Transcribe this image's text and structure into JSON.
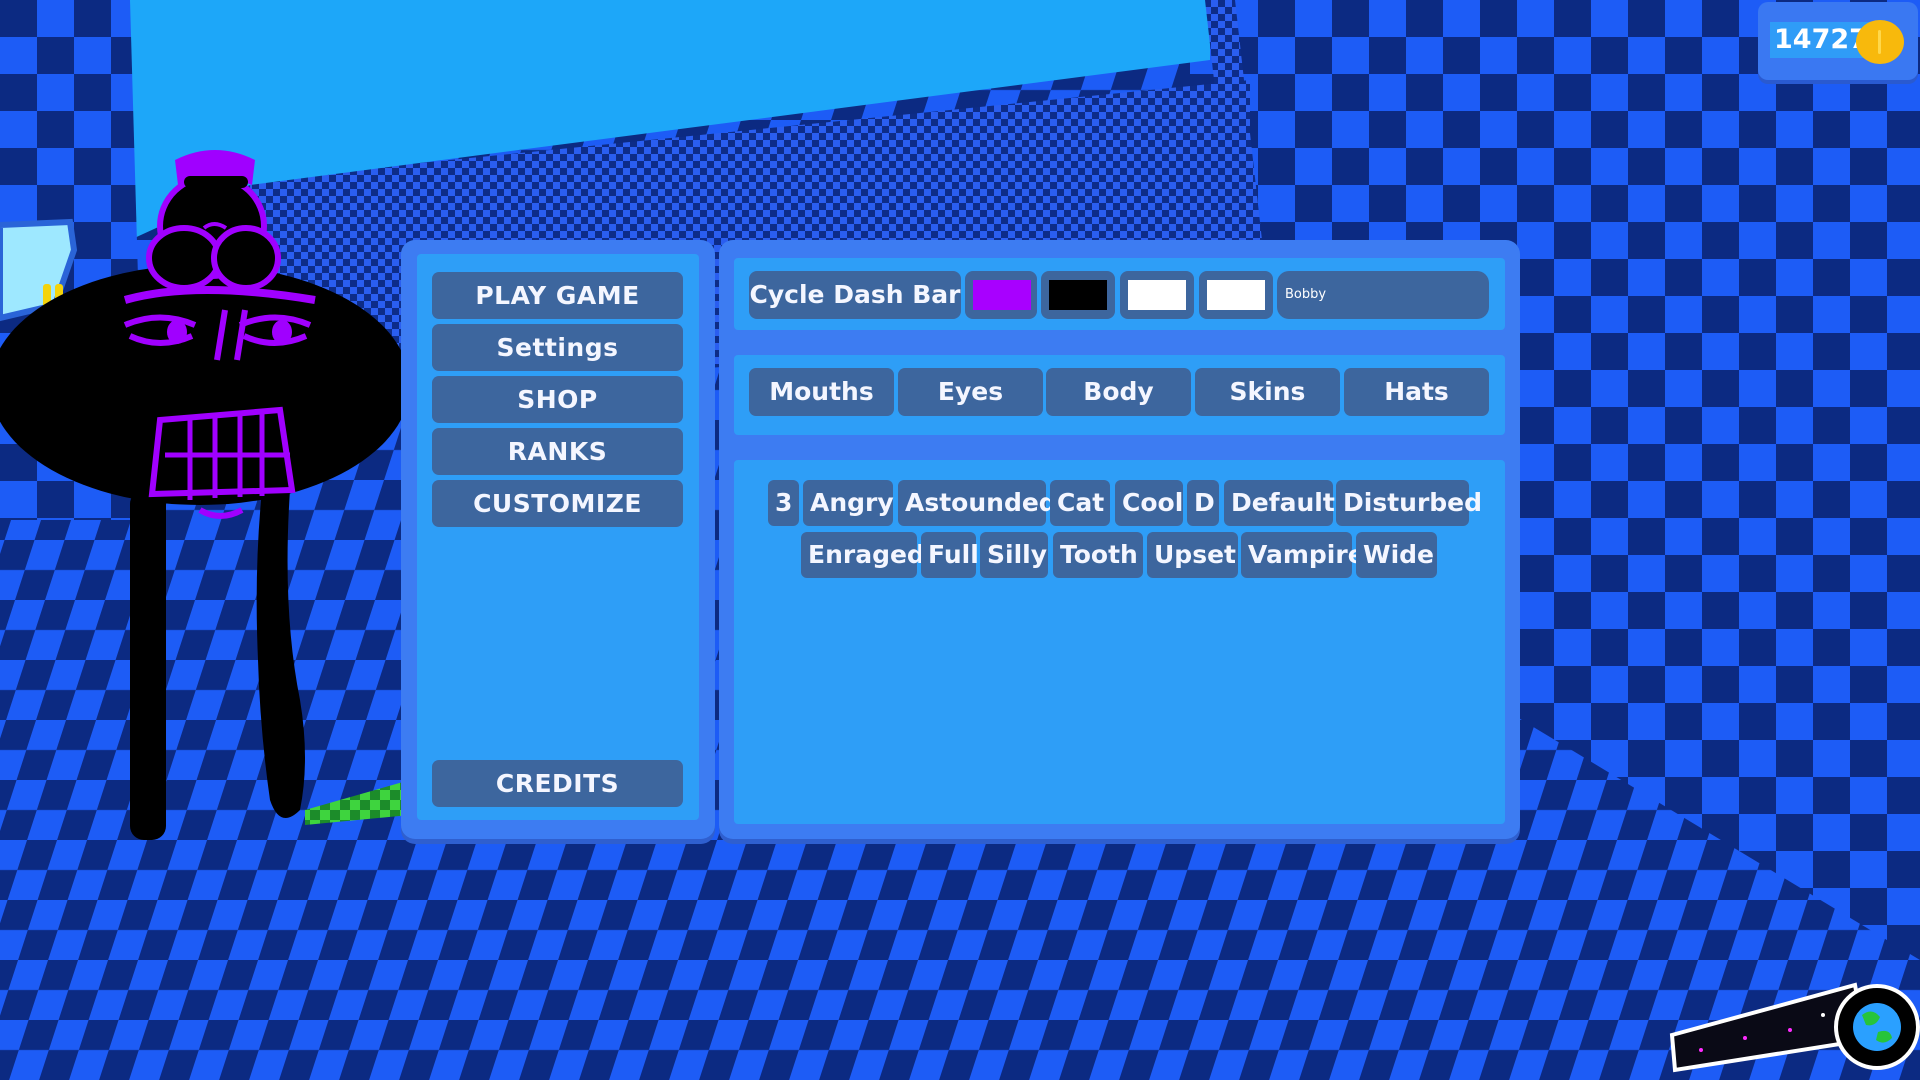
{
  "hud": {
    "coins": "14727"
  },
  "menu": {
    "play": "PLAY GAME",
    "settings": "Settings",
    "shop": "SHOP",
    "ranks": "RANKS",
    "customize": "CUSTOMIZE",
    "credits": "CREDITS"
  },
  "customize": {
    "cycle_label": "Cycle Dash Bar",
    "colors": [
      "#a800ff",
      "#000000",
      "#ffffff",
      "#ffffff"
    ],
    "name": "Bobby",
    "tabs": [
      "Mouths",
      "Eyes",
      "Body",
      "Skins",
      "Hats"
    ],
    "mouths": [
      "3",
      "Angry",
      "Astounded",
      "Cat",
      "Cool",
      "D",
      "Default",
      "Disturbed",
      "Enraged",
      "Full",
      "Silly",
      "Tooth",
      "Upset",
      "Vampire",
      "Wide"
    ]
  }
}
